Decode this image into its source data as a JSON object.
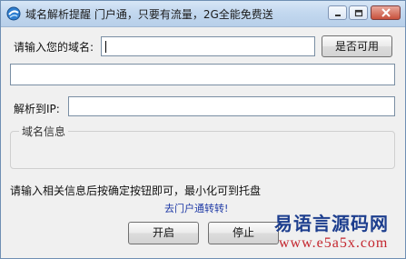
{
  "window": {
    "title": "域名解析提醒 门户通，只要有流量，2G全能免费送",
    "buttons": {
      "minimize": "minimize-icon",
      "maximize": "maximize-icon",
      "close": "close-icon"
    }
  },
  "form": {
    "domain_label": "请输入您的域名:",
    "domain_value": "",
    "check_button": "是否可用",
    "result_value": "",
    "ip_label": "解析到IP:",
    "ip_value": "",
    "group_title": "域名信息"
  },
  "hint": "请输入相关信息后按确定按钮即可，最小化可到托盘",
  "link": "去门户通转转!",
  "actions": {
    "start": "开启",
    "stop": "停止"
  },
  "watermark": {
    "text": "易语言源码网",
    "url": "www.e5a5x.com"
  }
}
